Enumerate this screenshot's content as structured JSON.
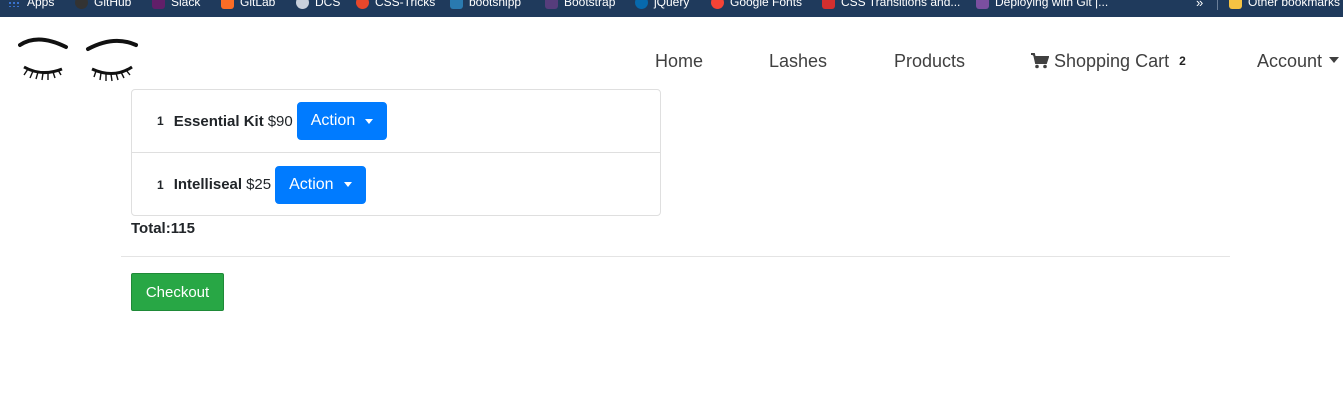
{
  "bookmarks": [
    {
      "label": "Apps",
      "icon": "apps-grid-icon"
    },
    {
      "label": "GitHub",
      "icon": "github-icon"
    },
    {
      "label": "Slack",
      "icon": "slack-icon"
    },
    {
      "label": "GitLab",
      "icon": "gitlab-icon"
    },
    {
      "label": "DCS",
      "icon": "dcs-icon"
    },
    {
      "label": "CSS-Tricks",
      "icon": "css-tricks-icon"
    },
    {
      "label": "bootsnipp",
      "icon": "bootsnipp-icon"
    },
    {
      "label": "Bootstrap",
      "icon": "bootstrap-icon"
    },
    {
      "label": "jQuery",
      "icon": "jquery-icon"
    },
    {
      "label": "Google Fonts",
      "icon": "google-fonts-icon"
    },
    {
      "label": "CSS Transitions and...",
      "icon": "css-transitions-icon"
    },
    {
      "label": "Deploying with Git |...",
      "icon": "git-deploy-icon"
    }
  ],
  "bookmarks_overflow": "»",
  "other_bookmarks": "Other bookmarks",
  "nav": {
    "home": "Home",
    "lashes": "Lashes",
    "products": "Products",
    "cart": "Shopping Cart",
    "cart_count": "2",
    "account": "Account"
  },
  "cart": {
    "items": [
      {
        "qty": "1",
        "name": "Essential Kit",
        "price": "$90",
        "action": "Action"
      },
      {
        "qty": "1",
        "name": "Intelliseal",
        "price": "$25",
        "action": "Action"
      }
    ],
    "total": "Total:115",
    "checkout": "Checkout"
  },
  "colors": {
    "primary": "#007bff",
    "success": "#28a745",
    "bookmarks_bar": "#1f3a5c"
  }
}
